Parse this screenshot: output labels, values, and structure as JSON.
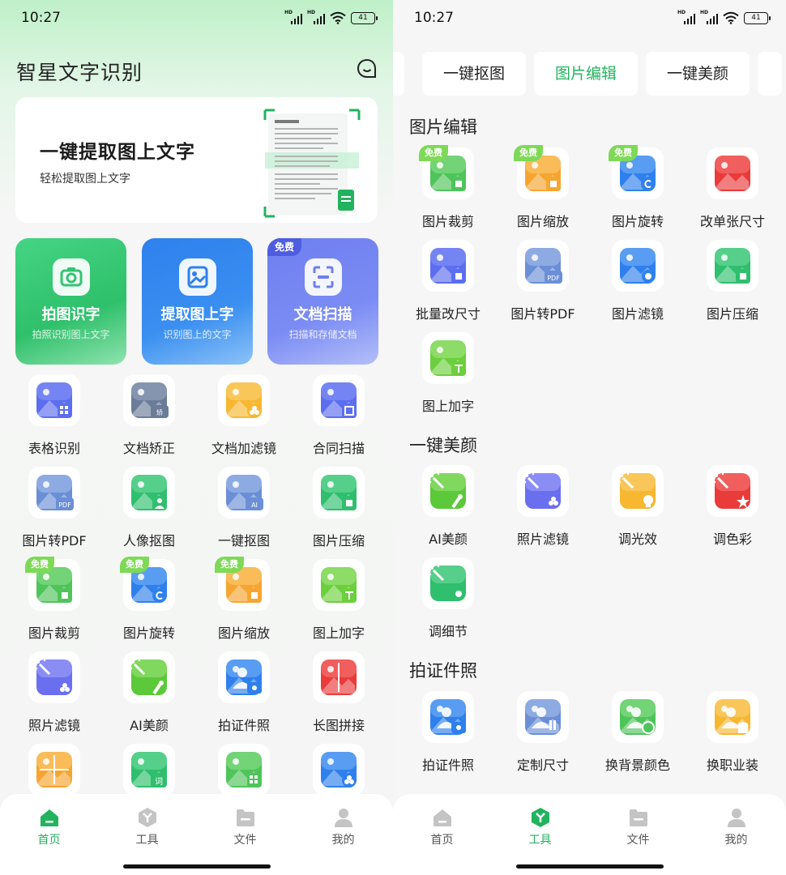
{
  "colors": {
    "accent": "#22b35e",
    "free_tag": "#7ed957",
    "card_green": "#3dcc79",
    "card_blue": "#2f80ed",
    "card_purple": "#6f85f2"
  },
  "status_bar": {
    "time": "10:27",
    "battery": "41",
    "hd1": "HD",
    "hd2": "HD"
  },
  "home": {
    "title": "智星文字识别",
    "banner": {
      "title": "一键提取图上文字",
      "subtitle": "轻松提取图上文字"
    },
    "big_cards": [
      {
        "title": "拍图识字",
        "subtitle": "拍照识别图上文字",
        "icon": "camera-icon"
      },
      {
        "title": "提取图上字",
        "subtitle": "识别图上的文字",
        "icon": "image-icon"
      },
      {
        "title": "文档扫描",
        "subtitle": "扫描和存储文档",
        "icon": "scan-icon",
        "tag": "免费"
      }
    ],
    "grid": [
      {
        "label": "表格识别",
        "icon": "table-icon"
      },
      {
        "label": "文档矫正",
        "icon": "doc-correct-icon",
        "badge": "矫"
      },
      {
        "label": "文档加滤镜",
        "icon": "doc-filter-icon"
      },
      {
        "label": "合同扫描",
        "icon": "contract-scan-icon"
      },
      {
        "label": "图片转PDF",
        "icon": "image-pdf-icon",
        "badge": "PDF"
      },
      {
        "label": "人像抠图",
        "icon": "portrait-cutout-icon"
      },
      {
        "label": "一键抠图",
        "icon": "ai-cutout-icon",
        "badge": "AI"
      },
      {
        "label": "图片压缩",
        "icon": "image-compress-icon"
      },
      {
        "label": "图片裁剪",
        "icon": "image-crop-icon",
        "tag": "免费"
      },
      {
        "label": "图片旋转",
        "icon": "image-rotate-icon",
        "tag": "免费"
      },
      {
        "label": "图片缩放",
        "icon": "image-scale-icon",
        "tag": "免费"
      },
      {
        "label": "图上加字",
        "icon": "image-text-icon"
      },
      {
        "label": "照片滤镜",
        "icon": "photo-filter-icon"
      },
      {
        "label": "AI美颜",
        "icon": "ai-beauty-icon"
      },
      {
        "label": "拍证件照",
        "icon": "id-photo-icon"
      },
      {
        "label": "长图拼接",
        "icon": "long-image-icon"
      },
      {
        "label": "",
        "icon": "grid-apps-icon"
      },
      {
        "label": "",
        "icon": "word-icon",
        "badge": "词"
      },
      {
        "label": "",
        "icon": "image-mosaic-icon"
      },
      {
        "label": "",
        "icon": "image-sticker-icon"
      }
    ],
    "tabs": [
      {
        "label": "首页",
        "icon": "home-icon"
      },
      {
        "label": "工具",
        "icon": "tools-icon"
      },
      {
        "label": "文件",
        "icon": "folder-icon"
      },
      {
        "label": "我的",
        "icon": "user-icon"
      }
    ]
  },
  "tools": {
    "chips": [
      "一键抠图",
      "图片编辑",
      "一键美颜"
    ],
    "sections": [
      {
        "title": "图片编辑",
        "items": [
          {
            "label": "图片裁剪",
            "icon": "image-crop-icon",
            "tag": "免费"
          },
          {
            "label": "图片缩放",
            "icon": "image-scale-icon",
            "tag": "免费"
          },
          {
            "label": "图片旋转",
            "icon": "image-rotate-icon",
            "tag": "免费"
          },
          {
            "label": "改单张尺寸",
            "icon": "resize-single-icon"
          },
          {
            "label": "批量改尺寸",
            "icon": "batch-resize-icon"
          },
          {
            "label": "图片转PDF",
            "icon": "image-pdf-icon",
            "badge": "PDF"
          },
          {
            "label": "图片滤镜",
            "icon": "image-filter-icon"
          },
          {
            "label": "图片压缩",
            "icon": "image-compress-icon"
          },
          {
            "label": "图上加字",
            "icon": "image-text-icon"
          }
        ]
      },
      {
        "title": "一键美颜",
        "items": [
          {
            "label": "AI美颜",
            "icon": "ai-beauty-icon"
          },
          {
            "label": "照片滤镜",
            "icon": "photo-filter-icon"
          },
          {
            "label": "调光效",
            "icon": "light-effect-icon"
          },
          {
            "label": "调色彩",
            "icon": "color-adjust-icon"
          },
          {
            "label": "调细节",
            "icon": "detail-adjust-icon"
          }
        ]
      },
      {
        "title": "拍证件照",
        "items": [
          {
            "label": "拍证件照",
            "icon": "id-photo-icon"
          },
          {
            "label": "定制尺寸",
            "icon": "custom-size-icon"
          },
          {
            "label": "换背景颜色",
            "icon": "change-bg-icon"
          },
          {
            "label": "换职业装",
            "icon": "change-suit-icon"
          }
        ]
      }
    ]
  }
}
